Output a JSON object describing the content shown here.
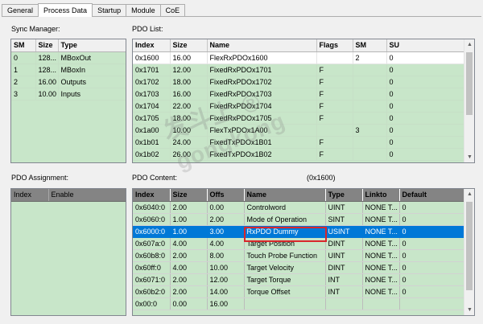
{
  "tabs": [
    "General",
    "Process Data",
    "Startup",
    "Module",
    "CoE"
  ],
  "active_tab": "Process Data",
  "sync_manager": {
    "caption": "Sync Manager:",
    "columns": [
      "SM",
      "Size",
      "Type"
    ],
    "rows": [
      [
        "0",
        "128...",
        "MBoxOut"
      ],
      [
        "1",
        "128...",
        "MBoxIn"
      ],
      [
        "2",
        "16.00",
        "Outputs"
      ],
      [
        "3",
        "10.00",
        "Inputs"
      ]
    ]
  },
  "pdo_list": {
    "caption": "PDO List:",
    "columns": [
      "Index",
      "Size",
      "Name",
      "Flags",
      "SM",
      "SU"
    ],
    "rows": [
      [
        "0x1600",
        "16.00",
        "FlexRxPDOx1600",
        "",
        "2",
        "0"
      ],
      [
        "0x1701",
        "12.00",
        "FixedRxPDOx1701",
        "F",
        "",
        "0"
      ],
      [
        "0x1702",
        "18.00",
        "FixedRxPDOx1702",
        "F",
        "",
        "0"
      ],
      [
        "0x1703",
        "16.00",
        "FixedRxPDOx1703",
        "F",
        "",
        "0"
      ],
      [
        "0x1704",
        "22.00",
        "FixedRxPDOx1704",
        "F",
        "",
        "0"
      ],
      [
        "0x1705",
        "18.00",
        "FixedRxPDOx1705",
        "F",
        "",
        "0"
      ],
      [
        "0x1a00",
        "10.00",
        "FlexTxPDOx1A00",
        "",
        "3",
        "0"
      ],
      [
        "0x1b01",
        "24.00",
        "FixedTxPDOx1B01",
        "F",
        "",
        "0"
      ],
      [
        "0x1b02",
        "26.00",
        "FixedTxPDOx1B02",
        "F",
        "",
        "0"
      ]
    ]
  },
  "pdo_assignment": {
    "caption": "PDO Assignment:",
    "columns": [
      "Index",
      "Enable"
    ]
  },
  "pdo_content": {
    "caption": "PDO Content:",
    "context": "(0x1600)",
    "columns": [
      "Index",
      "Size",
      "Offs",
      "Name",
      "Type",
      "Linkto",
      "Default"
    ],
    "rows": [
      [
        "0x6040:0",
        "2.00",
        "0.00",
        "Controlword",
        "UINT",
        "NONE T...",
        "0"
      ],
      [
        "0x6060:0",
        "1.00",
        "2.00",
        "Mode of Operation",
        "SINT",
        "NONE T...",
        "0"
      ],
      [
        "0x6000:0",
        "1.00",
        "3.00",
        "RxPDO Dummy",
        "USINT",
        "NONE T...",
        "0"
      ],
      [
        "0x607a:0",
        "4.00",
        "4.00",
        "Target Position",
        "DINT",
        "NONE T...",
        "0"
      ],
      [
        "0x60b8:0",
        "2.00",
        "8.00",
        "Touch Probe Function",
        "UINT",
        "NONE T...",
        "0"
      ],
      [
        "0x60ff:0",
        "4.00",
        "10.00",
        "Target Velocity",
        "DINT",
        "NONE T...",
        "0"
      ],
      [
        "0x6071:0",
        "2.00",
        "12.00",
        "Target Torque",
        "INT",
        "NONE T...",
        "0"
      ],
      [
        "0x60b2:0",
        "2.00",
        "14.00",
        "Torque Offset",
        "INT",
        "NONE T...",
        "0"
      ],
      [
        "0x00:0",
        "0.00",
        "16.00",
        "",
        "",
        "",
        ""
      ]
    ],
    "selected_row": 2
  },
  "watermark": {
    "line1": "发斗上 ®",
    "line2": "gongkong"
  }
}
